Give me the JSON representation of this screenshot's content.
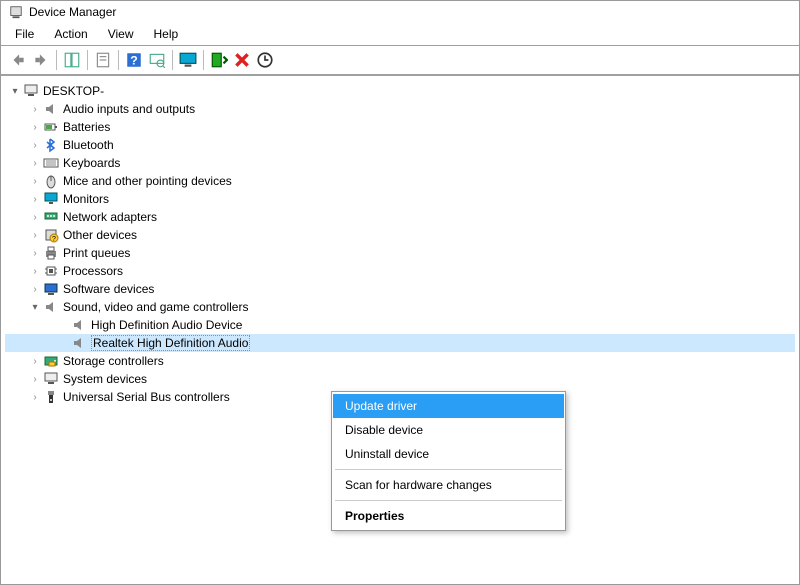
{
  "window": {
    "title": "Device Manager"
  },
  "menu": {
    "file": "File",
    "action": "Action",
    "view": "View",
    "help": "Help"
  },
  "tree": {
    "root": "DESKTOP-",
    "items": [
      {
        "label": "Audio inputs and outputs",
        "icon": "speaker"
      },
      {
        "label": "Batteries",
        "icon": "battery"
      },
      {
        "label": "Bluetooth",
        "icon": "bluetooth"
      },
      {
        "label": "Keyboards",
        "icon": "keyboard"
      },
      {
        "label": "Mice and other pointing devices",
        "icon": "mouse"
      },
      {
        "label": "Monitors",
        "icon": "monitor"
      },
      {
        "label": "Network adapters",
        "icon": "network"
      },
      {
        "label": "Other devices",
        "icon": "other"
      },
      {
        "label": "Print queues",
        "icon": "printer"
      },
      {
        "label": "Processors",
        "icon": "cpu"
      },
      {
        "label": "Software devices",
        "icon": "software"
      }
    ],
    "sound": {
      "label": "Sound, video and game controllers",
      "children": [
        {
          "label": "High Definition Audio Device"
        },
        {
          "label": "Realtek High Definition Audio",
          "selected": true
        }
      ]
    },
    "after": [
      {
        "label": "Storage controllers",
        "icon": "storage"
      },
      {
        "label": "System devices",
        "icon": "system"
      },
      {
        "label": "Universal Serial Bus controllers",
        "icon": "usb"
      }
    ]
  },
  "context_menu": {
    "items": [
      {
        "label": "Update driver",
        "highlight": true
      },
      {
        "label": "Disable device"
      },
      {
        "label": "Uninstall device"
      }
    ],
    "scan": "Scan for hardware changes",
    "properties": "Properties"
  }
}
